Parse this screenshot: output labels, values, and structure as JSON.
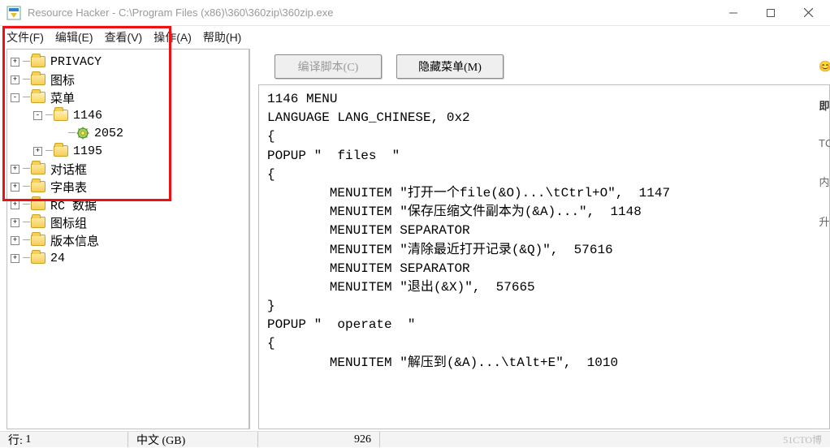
{
  "title": "Resource Hacker  -  C:\\Program Files (x86)\\360\\360zip\\360zip.exe",
  "menus": {
    "file": "文件(F)",
    "edit": "编辑(E)",
    "view": "查看(V)",
    "action": "操作(A)",
    "help": "帮助(H)"
  },
  "tree": [
    {
      "expander": "+",
      "indent": 0,
      "icon": "folder",
      "label": "PRIVACY"
    },
    {
      "expander": "+",
      "indent": 0,
      "icon": "folder",
      "label": "图标"
    },
    {
      "expander": "-",
      "indent": 0,
      "icon": "folder-open",
      "label": "菜单"
    },
    {
      "expander": "-",
      "indent": 1,
      "icon": "folder-open",
      "label": "1146"
    },
    {
      "expander": "",
      "indent": 2,
      "icon": "gear",
      "label": "2052"
    },
    {
      "expander": "+",
      "indent": 1,
      "icon": "folder",
      "label": "1195"
    },
    {
      "expander": "+",
      "indent": 0,
      "icon": "folder",
      "label": "对话框"
    },
    {
      "expander": "+",
      "indent": 0,
      "icon": "folder",
      "label": "字串表"
    },
    {
      "expander": "+",
      "indent": 0,
      "icon": "folder",
      "label": "RC 数据"
    },
    {
      "expander": "+",
      "indent": 0,
      "icon": "folder",
      "label": "图标组"
    },
    {
      "expander": "+",
      "indent": 0,
      "icon": "folder",
      "label": "版本信息"
    },
    {
      "expander": "+",
      "indent": 0,
      "icon": "folder",
      "label": "24"
    }
  ],
  "buttons": {
    "compile": "编译脚本(C)",
    "hideMenu": "隐藏菜单(M)"
  },
  "code": "1146 MENU\nLANGUAGE LANG_CHINESE, 0x2\n{\nPOPUP \"  files  \"\n{\n\tMENUITEM \"打开一个file(&O)...\\tCtrl+O\",  1147\n\tMENUITEM \"保存压缩文件副本为(&A)...\",  1148\n\tMENUITEM SEPARATOR\n\tMENUITEM \"清除最近打开记录(&Q)\",  57616\n\tMENUITEM SEPARATOR\n\tMENUITEM \"退出(&X)\",  57665\n}\nPOPUP \"  operate  \"\n{\n\tMENUITEM \"解压到(&A)...\\tAlt+E\",  1010",
  "status": {
    "line_label": "行:",
    "line_value": "1",
    "lang": "中文  (GB)",
    "col": "926"
  },
  "watermark": "51CTO博",
  "sideStrip": [
    "😊",
    "即",
    "TC",
    "内",
    "升"
  ]
}
